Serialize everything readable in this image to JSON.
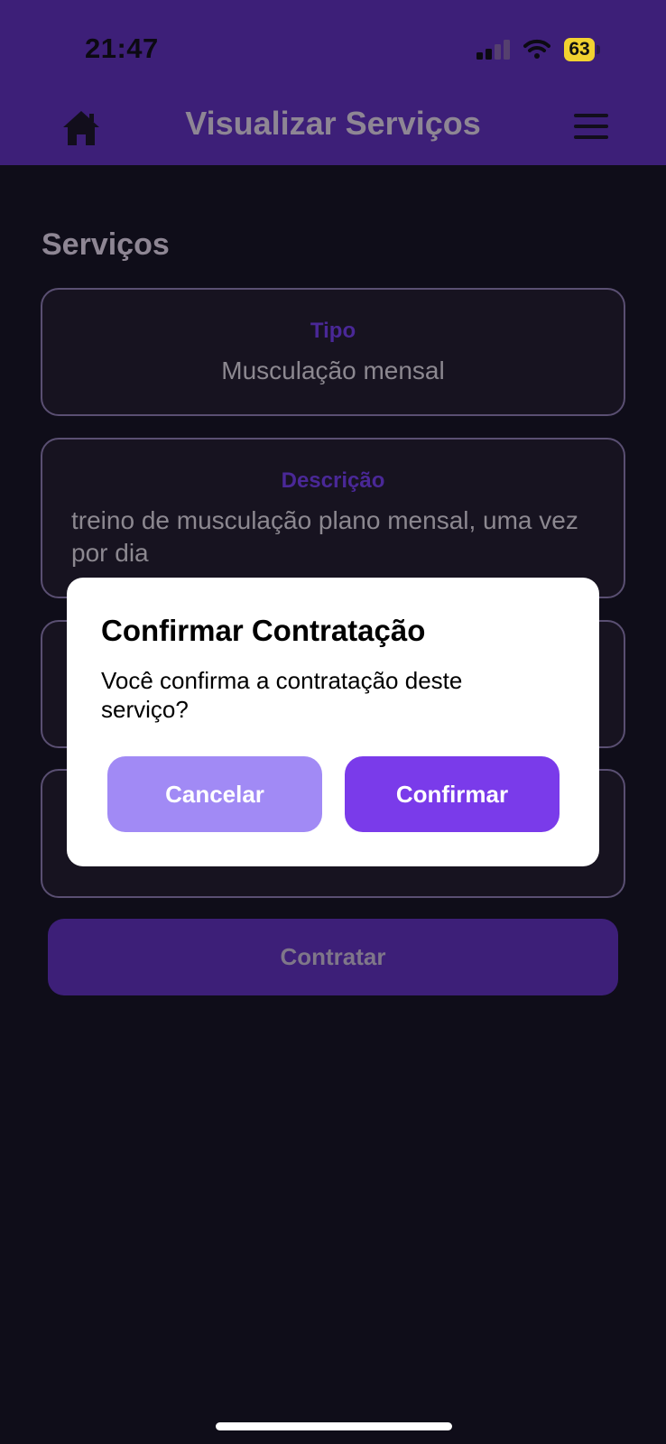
{
  "status_bar": {
    "time": "21:47",
    "battery": "63",
    "battery_color": "#f2d230"
  },
  "header": {
    "title": "Visualizar Serviços",
    "home_icon": "home-icon",
    "menu_icon": "hamburger-menu-icon",
    "background": "#3d1f78"
  },
  "main": {
    "section_title": "Serviços",
    "fields": [
      {
        "label": "Tipo",
        "value": "Musculação mensal"
      },
      {
        "label": "Descrição",
        "value": "treino de musculação plano mensal, uma vez por dia"
      }
    ],
    "contract_button": "Contratar"
  },
  "dialog": {
    "title": "Confirmar Contratação",
    "message": "Você confirma a contratação deste serviço?",
    "cancel_label": "Cancelar",
    "confirm_label": "Confirmar",
    "cancel_color": "#a18af5",
    "confirm_color": "#7a3bea"
  }
}
